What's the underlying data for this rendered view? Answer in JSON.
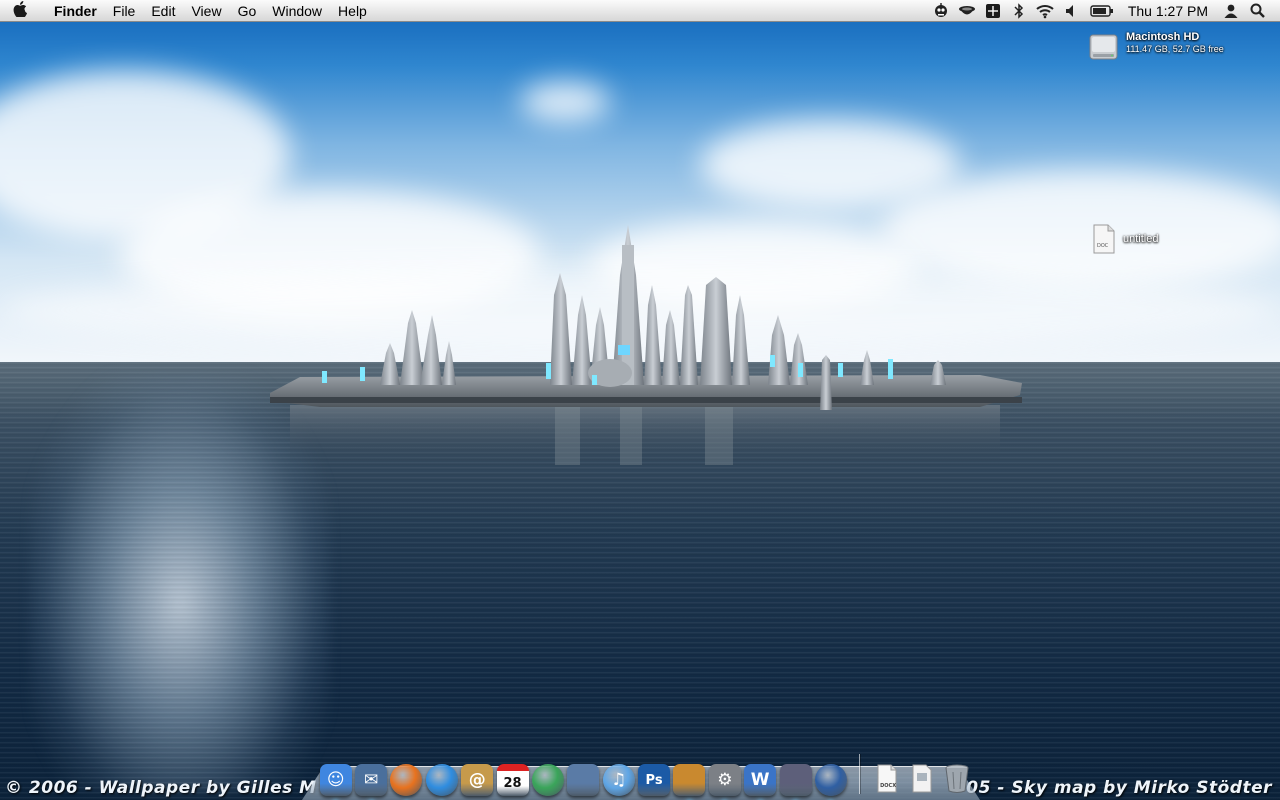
{
  "menubar": {
    "apple_icon": "apple-logo-icon",
    "app_name": "Finder",
    "menus": [
      "File",
      "Edit",
      "View",
      "Go",
      "Window",
      "Help"
    ],
    "status_icons": [
      "robot-icon",
      "coffee-cup-icon",
      "spaces-icon",
      "bluetooth-icon",
      "wifi-icon",
      "volume-icon",
      "battery-icon"
    ],
    "clock": "Thu 1:27 PM",
    "user_icon": "user-icon",
    "spotlight_icon": "magnifier-icon"
  },
  "desktop": {
    "drive": {
      "name": "Macintosh HD",
      "info": "111.47 GB, 52.7 GB free",
      "icon": "hard-drive-icon"
    },
    "file": {
      "name": "untitled",
      "badge": "DOC",
      "icon": "document-icon"
    }
  },
  "wallpaper": {
    "credit_left": "© 2006  -  Wallpaper by Gilles M",
    "credit_right": "05  -  Sky map by Mirko Stödter"
  },
  "dock": {
    "apps": [
      {
        "name": "finder",
        "icon": "finder-icon",
        "text": "☺",
        "bg": "#3f86e0"
      },
      {
        "name": "mail-app",
        "icon": "mail-stamp-icon",
        "text": "✉",
        "bg": "#4a6f9c"
      },
      {
        "name": "firefox",
        "icon": "firefox-icon",
        "text": "",
        "bg": "#e8721e"
      },
      {
        "name": "safari",
        "icon": "safari-compass-icon",
        "text": "",
        "bg": "#2f8de0"
      },
      {
        "name": "address-book",
        "icon": "address-book-icon",
        "text": "@",
        "bg": "#c69a4b"
      },
      {
        "name": "ical",
        "icon": "calendar-icon",
        "text": "28",
        "bg": "#ffffff"
      },
      {
        "name": "messenger",
        "icon": "messenger-people-icon",
        "text": "",
        "bg": "#3aa55a"
      },
      {
        "name": "iphoto",
        "icon": "iphoto-icon",
        "text": "",
        "bg": "#5a7ba6"
      },
      {
        "name": "itunes",
        "icon": "itunes-icon",
        "text": "♫",
        "bg": "#5fa6e6"
      },
      {
        "name": "photoshop",
        "icon": "photoshop-icon",
        "text": "Ps",
        "bg": "#1b5aa6"
      },
      {
        "name": "image-capture",
        "icon": "camera-photo-icon",
        "text": "",
        "bg": "#c9892f"
      },
      {
        "name": "system-preferences",
        "icon": "gear-switch-icon",
        "text": "⚙",
        "bg": "#7c8086"
      },
      {
        "name": "word",
        "icon": "word-icon",
        "text": "W",
        "bg": "#3a74c7"
      },
      {
        "name": "script-editor",
        "icon": "quill-icon",
        "text": "",
        "bg": "#5d5f7a"
      },
      {
        "name": "adium",
        "icon": "duck-icon",
        "text": "",
        "bg": "#2f5fa3"
      }
    ],
    "stack": [
      {
        "name": "docx-stack",
        "icon": "docx-document-icon",
        "text": "DOCX"
      },
      {
        "name": "downloads-stack",
        "icon": "document-stack-icon",
        "text": ""
      },
      {
        "name": "trash",
        "icon": "trash-icon",
        "text": ""
      }
    ],
    "running": [
      "finder",
      "mail-app",
      "firefox",
      "safari",
      "itunes",
      "image-capture",
      "system-preferences",
      "word",
      "script-editor",
      "adium"
    ]
  }
}
